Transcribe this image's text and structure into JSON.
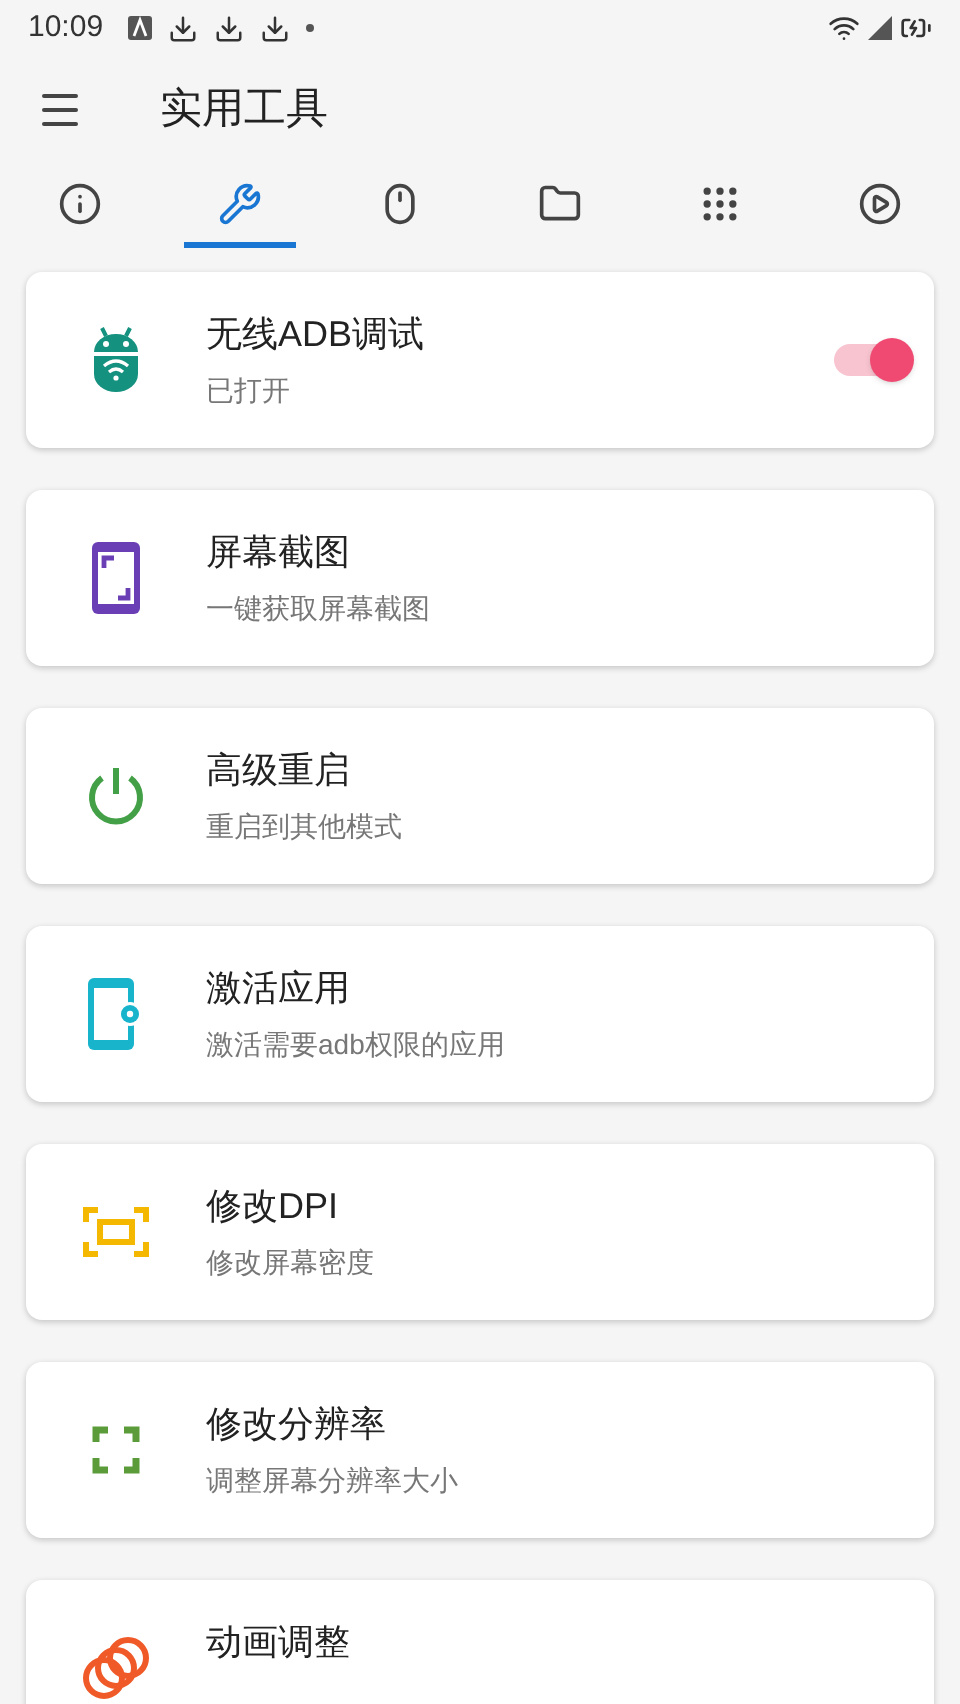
{
  "status_bar": {
    "time": "10:09"
  },
  "toolbar": {
    "title": "实用工具"
  },
  "tabs": [
    {
      "kind": "info",
      "selected": false
    },
    {
      "kind": "tools",
      "selected": true
    },
    {
      "kind": "mouse",
      "selected": false
    },
    {
      "kind": "folder",
      "selected": false
    },
    {
      "kind": "apps",
      "selected": false
    },
    {
      "kind": "play",
      "selected": false
    }
  ],
  "tools": [
    {
      "kind": "adb",
      "title": "无线ADB调试",
      "subtitle": "已打开",
      "switch_on": true
    },
    {
      "kind": "screenshot",
      "title": "屏幕截图",
      "subtitle": "一键获取屏幕截图"
    },
    {
      "kind": "reboot",
      "title": "高级重启",
      "subtitle": "重启到其他模式"
    },
    {
      "kind": "activate",
      "title": "激活应用",
      "subtitle": "激活需要adb权限的应用"
    },
    {
      "kind": "dpi",
      "title": "修改DPI",
      "subtitle": "修改屏幕密度"
    },
    {
      "kind": "resolution",
      "title": "修改分辨率",
      "subtitle": "调整屏幕分辨率大小"
    },
    {
      "kind": "animation",
      "title": "动画调整"
    }
  ]
}
